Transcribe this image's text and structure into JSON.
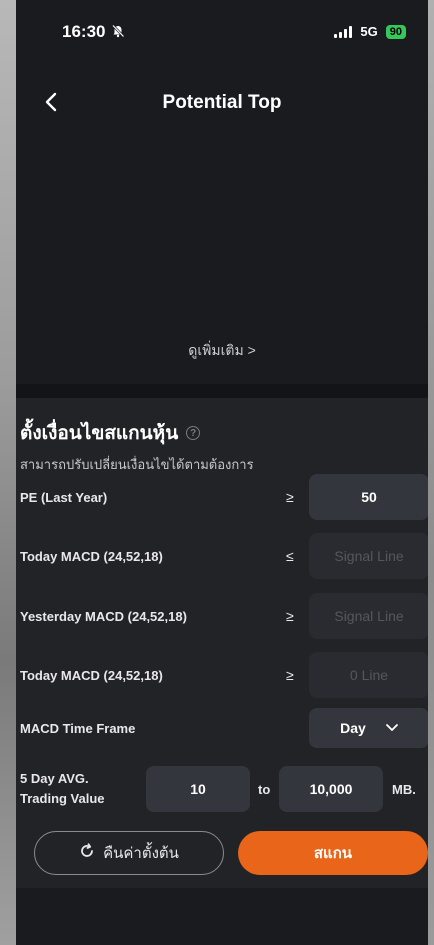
{
  "status": {
    "time": "16:30",
    "network": "5G",
    "battery": "90"
  },
  "nav": {
    "title": "Potential Top",
    "back_icon": "chevron-left-icon"
  },
  "top": {
    "see_more": "ดูเพิ่มเติม >"
  },
  "filter": {
    "title": "ตั้งเงื่อนไขสแกนหุ้น",
    "subtitle": "สามารถปรับเปลี่ยนเงื่อนไขได้ตามต้องการ",
    "rows": [
      {
        "label": "PE (Last Year)",
        "op": "≥",
        "value": "50"
      },
      {
        "label": "Today MACD (24,52,18)",
        "op": "≤",
        "value": "Signal Line"
      },
      {
        "label": "Yesterday MACD (24,52,18)",
        "op": "≥",
        "value": "Signal Line"
      },
      {
        "label": "Today MACD (24,52,18)",
        "op": "≥",
        "value": "0 Line"
      }
    ],
    "timeframe": {
      "label": "MACD Time Frame",
      "selected": "Day"
    },
    "trading": {
      "label_line1": "5 Day AVG.",
      "label_line2": "Trading Value",
      "from": "10",
      "to_label": "to",
      "to": "10,000",
      "unit": "MB."
    },
    "reset_label": "คืนค่าตั้งต้น",
    "scan_label": "สแกน"
  },
  "colors": {
    "accent": "#e8651a",
    "background": "#1a1b1f",
    "panel": "#222327"
  }
}
